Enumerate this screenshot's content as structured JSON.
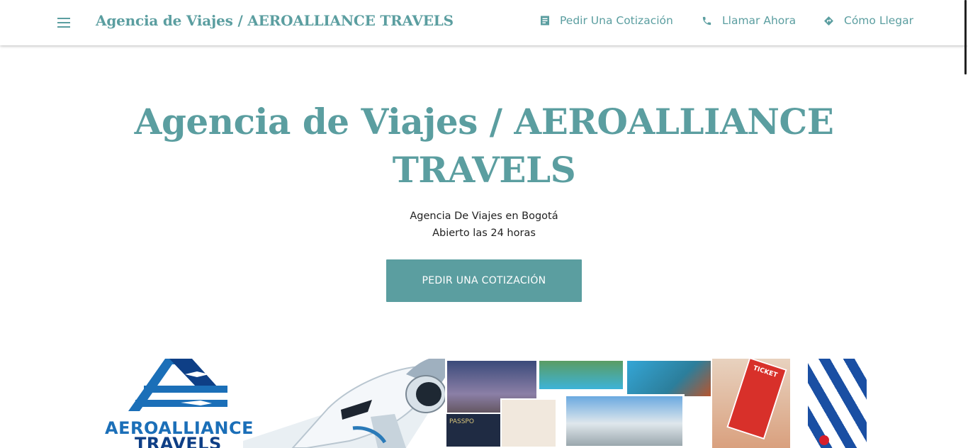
{
  "header": {
    "brand": "Agencia de Viajes / AEROALLIANCE TRAVELS",
    "nav": [
      {
        "label": "Pedir Una Cotización",
        "icon": "document-icon"
      },
      {
        "label": "Llamar Ahora",
        "icon": "phone-icon"
      },
      {
        "label": "Cómo Llegar",
        "icon": "directions-icon"
      }
    ]
  },
  "hero": {
    "title": "Agencia de Viajes / AEROALLIANCE TRAVELS",
    "category": "Agencia De Viajes en Bogotá",
    "hours": "Abierto las 24 horas",
    "cta": "PEDIR UNA COTIZACIÓN"
  },
  "banner": {
    "logo_line1": "AEROALLIANCE",
    "logo_line2": "TRAVELS",
    "collage_ticket_text": "TICKET",
    "collage_passport_text": "PASSPO",
    "colors": {
      "accent": "#5b9ea0",
      "logo_blue": "#1b6fb8",
      "logo_navy": "#0e3f86"
    }
  }
}
